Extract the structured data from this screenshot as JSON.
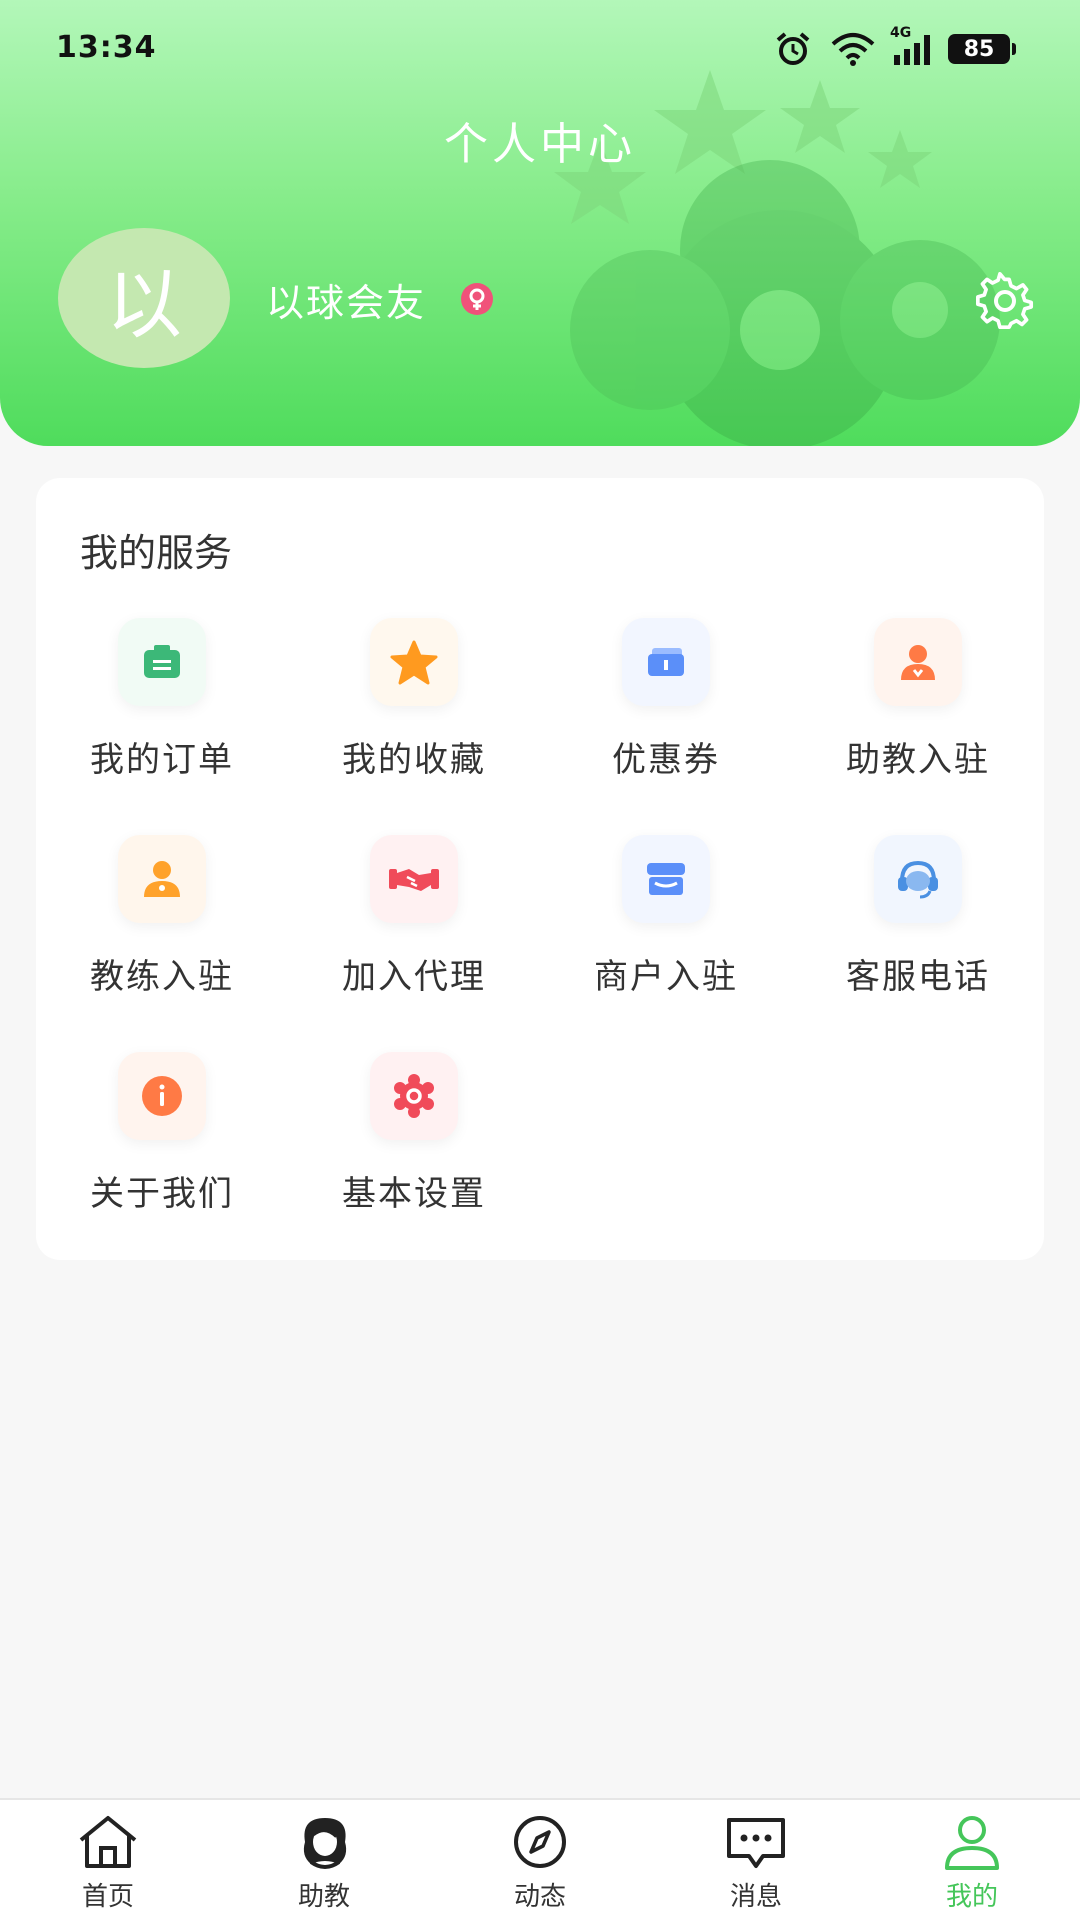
{
  "status_bar": {
    "time": "13:34",
    "network": "4G",
    "battery": "85"
  },
  "header": {
    "title": "个人中心",
    "avatar_text": "以",
    "username": "以球会友"
  },
  "services": {
    "title": "我的服务",
    "items": [
      {
        "label": "我的订单",
        "icon": "order-icon",
        "color": "#3cb878"
      },
      {
        "label": "我的收藏",
        "icon": "star-icon",
        "color": "#ff9a1f"
      },
      {
        "label": "优惠券",
        "icon": "coupon-icon",
        "color": "#5b8ff9"
      },
      {
        "label": "助教入驻",
        "icon": "assistant-icon",
        "color": "#ff7a45"
      },
      {
        "label": "教练入驻",
        "icon": "coach-icon",
        "color": "#ffa22b"
      },
      {
        "label": "加入代理",
        "icon": "handshake-icon",
        "color": "#f04b5a"
      },
      {
        "label": "商户入驻",
        "icon": "store-icon",
        "color": "#5b8ff9"
      },
      {
        "label": "客服电话",
        "icon": "headset-icon",
        "color": "#4a90e2"
      },
      {
        "label": "关于我们",
        "icon": "info-icon",
        "color": "#ff7a45"
      },
      {
        "label": "基本设置",
        "icon": "gear-icon",
        "color": "#f04b5a"
      }
    ]
  },
  "tabbar": {
    "items": [
      {
        "label": "首页",
        "icon": "home-icon"
      },
      {
        "label": "助教",
        "icon": "assistant-avatar-icon"
      },
      {
        "label": "动态",
        "icon": "compass-icon"
      },
      {
        "label": "消息",
        "icon": "message-icon"
      },
      {
        "label": "我的",
        "icon": "user-icon",
        "active": true
      }
    ],
    "active_color": "#45c65a"
  }
}
